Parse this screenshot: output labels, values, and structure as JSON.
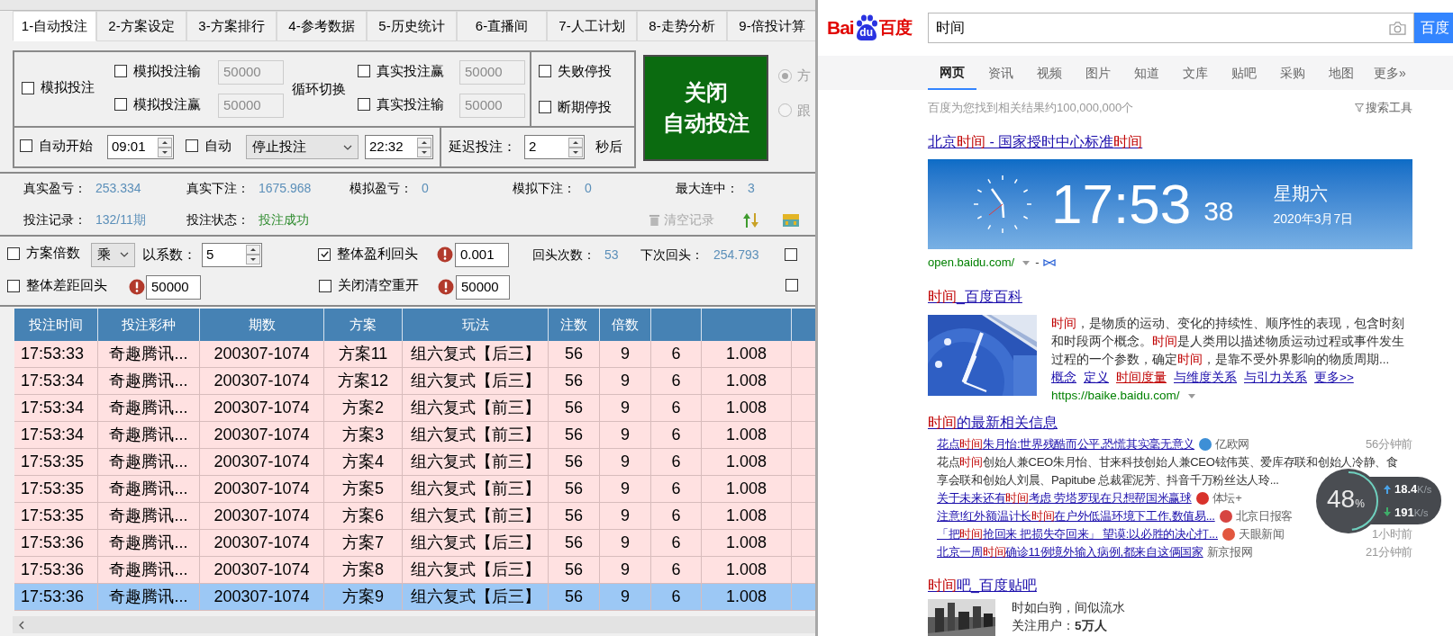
{
  "app": {
    "tabs": [
      {
        "label": "1-自动投注",
        "selected": true
      },
      {
        "label": "2-方案设定",
        "selected": false
      },
      {
        "label": "3-方案排行",
        "selected": false
      },
      {
        "label": "4-参考数据",
        "selected": false
      },
      {
        "label": "5-历史统计",
        "selected": false
      },
      {
        "label": "6-直播间",
        "selected": false
      },
      {
        "label": "7-人工计划",
        "selected": false
      },
      {
        "label": "8-走势分析",
        "selected": false
      },
      {
        "label": "9-倍投计算",
        "selected": false
      }
    ],
    "mode_panel": {
      "simulate": {
        "label": "模拟投注",
        "checked": false
      },
      "switch_rows": [
        {
          "label": "模拟投注输",
          "checked": false,
          "value": "50000",
          "disabled": true
        },
        {
          "label": "模拟投注赢",
          "checked": false,
          "value": "50000",
          "disabled": true
        }
      ],
      "cycle_label": "循环切换",
      "real_rows": [
        {
          "label": "真实投注赢",
          "checked": false,
          "value": "50000",
          "disabled": true
        },
        {
          "label": "真实投注输",
          "checked": false,
          "value": "50000",
          "disabled": true
        }
      ],
      "stop_options": [
        {
          "label": "失败停投",
          "checked": false
        },
        {
          "label": "断期停投",
          "checked": false
        }
      ],
      "toggle_button": [
        "关闭",
        "自动投注"
      ],
      "radios": [
        {
          "label": "方",
          "selected": true
        },
        {
          "label": "跟",
          "selected": false
        }
      ]
    },
    "schedule": {
      "auto_start": {
        "label": "自动开始",
        "checked": false
      },
      "start_time": "09:01",
      "auto": {
        "label": "自动",
        "checked": false
      },
      "action": "停止投注",
      "end_time": "22:32",
      "delay_label": "延迟投注：",
      "delay": "2",
      "delay_unit": "秒后"
    },
    "stats": [
      {
        "label": "真实盈亏：",
        "value": "253.334",
        "kind": "number"
      },
      {
        "label": "真实下注：",
        "value": "1675.968",
        "kind": "number"
      },
      {
        "label": "模拟盈亏：",
        "value": "0",
        "kind": "number"
      },
      {
        "label": "模拟下注：",
        "value": "0",
        "kind": "number"
      },
      {
        "label": "最大连中：",
        "value": "3",
        "kind": "number"
      }
    ],
    "records": [
      {
        "label": "投注记录：",
        "value": "132/11期",
        "kind": "number"
      },
      {
        "label": "投注状态：",
        "value": "投注成功",
        "kind": "status"
      }
    ],
    "clear_button": {
      "label": "清空记录",
      "disabled": true
    },
    "options": {
      "multiplier": {
        "label": "方案倍数",
        "checked": false
      },
      "operator": "乘",
      "factor_label": "以系数：",
      "factor": "5",
      "profit_return": {
        "label": "整体盈利回头",
        "checked": true,
        "value": "0.001"
      },
      "return_count_label": "回头次数：",
      "return_count": "53",
      "next_return_label": "下次回头：",
      "next_return": "254.793",
      "extra_checks": [
        {
          "checked": false
        },
        {
          "checked": false
        }
      ],
      "gap_return": {
        "label": "整体差距回头",
        "checked": false,
        "value": "50000"
      },
      "close_reset": {
        "label": "关闭清空重开",
        "checked": false,
        "value": "50000"
      }
    },
    "table": {
      "columns": [
        "投注时间",
        "投注彩种",
        "期数",
        "方案",
        "玩法",
        "注数",
        "倍数"
      ],
      "rows": [
        {
          "cells": [
            "17:53:33",
            "奇趣腾讯...",
            "200307-1074",
            "方案11",
            "组六复式【后三】",
            "56",
            "9",
            "6",
            "1.008"
          ],
          "selected": false
        },
        {
          "cells": [
            "17:53:34",
            "奇趣腾讯...",
            "200307-1074",
            "方案12",
            "组六复式【后三】",
            "56",
            "9",
            "6",
            "1.008"
          ],
          "selected": false
        },
        {
          "cells": [
            "17:53:34",
            "奇趣腾讯...",
            "200307-1074",
            "方案2",
            "组六复式【前三】",
            "56",
            "9",
            "6",
            "1.008"
          ],
          "selected": false
        },
        {
          "cells": [
            "17:53:34",
            "奇趣腾讯...",
            "200307-1074",
            "方案3",
            "组六复式【前三】",
            "56",
            "9",
            "6",
            "1.008"
          ],
          "selected": false
        },
        {
          "cells": [
            "17:53:35",
            "奇趣腾讯...",
            "200307-1074",
            "方案4",
            "组六复式【前三】",
            "56",
            "9",
            "6",
            "1.008"
          ],
          "selected": false
        },
        {
          "cells": [
            "17:53:35",
            "奇趣腾讯...",
            "200307-1074",
            "方案5",
            "组六复式【前三】",
            "56",
            "9",
            "6",
            "1.008"
          ],
          "selected": false
        },
        {
          "cells": [
            "17:53:35",
            "奇趣腾讯...",
            "200307-1074",
            "方案6",
            "组六复式【前三】",
            "56",
            "9",
            "6",
            "1.008"
          ],
          "selected": false
        },
        {
          "cells": [
            "17:53:36",
            "奇趣腾讯...",
            "200307-1074",
            "方案7",
            "组六复式【后三】",
            "56",
            "9",
            "6",
            "1.008"
          ],
          "selected": false
        },
        {
          "cells": [
            "17:53:36",
            "奇趣腾讯...",
            "200307-1074",
            "方案8",
            "组六复式【后三】",
            "56",
            "9",
            "6",
            "1.008"
          ],
          "selected": false
        },
        {
          "cells": [
            "17:53:36",
            "奇趣腾讯...",
            "200307-1074",
            "方案9",
            "组六复式【后三】",
            "56",
            "9",
            "6",
            "1.008"
          ],
          "selected": true
        }
      ]
    }
  },
  "browser": {
    "logo": [
      "Bai",
      "du",
      "百度"
    ],
    "search_query": "时间",
    "search_button": "百度",
    "nav": [
      {
        "label": "网页",
        "selected": true
      },
      {
        "label": "资讯",
        "selected": false
      },
      {
        "label": "视频",
        "selected": false
      },
      {
        "label": "图片",
        "selected": false
      },
      {
        "label": "知道",
        "selected": false
      },
      {
        "label": "文库",
        "selected": false
      },
      {
        "label": "贴吧",
        "selected": false
      },
      {
        "label": "采购",
        "selected": false
      },
      {
        "label": "地图",
        "selected": false
      },
      {
        "label": "更多»",
        "selected": false
      }
    ],
    "result_count": "百度为您找到相关结果约100,000,000个",
    "tools": "搜索工具",
    "clock_result": {
      "title": [
        {
          "text": "北京",
          "highlight": false
        },
        {
          "text": "时间",
          "highlight": true
        },
        {
          "text": " - 国家授时中心标准",
          "highlight": false
        },
        {
          "text": "时间",
          "highlight": true
        }
      ],
      "time": "17:53",
      "seconds": "38",
      "weekday": "星期六",
      "date": "2020年3月7日",
      "url": "open.baidu.com/",
      "separator": "-"
    },
    "baike_result": {
      "title": [
        {
          "text": "时间",
          "highlight": true
        },
        {
          "text": "_百度百科",
          "highlight": false
        }
      ],
      "snippet": [
        {
          "text": "时间",
          "highlight": true
        },
        {
          "text": "，是物质的运动、变化的持续性、顺序性的表现，包含时刻和时段两个概念。",
          "highlight": false
        },
        {
          "text": "时间",
          "highlight": true
        },
        {
          "text": "是人类用以描述物质运动过程或事件发生过程的一个参数，确定",
          "highlight": false
        },
        {
          "text": "时间",
          "highlight": true
        },
        {
          "text": "，是靠不受外界影响的物质周期...",
          "highlight": false
        }
      ],
      "links": [
        {
          "text": "概念",
          "highlight": false
        },
        {
          "text": "定义",
          "highlight": false
        },
        {
          "text": "时间度量",
          "highlight": true
        },
        {
          "text": "与维度关系",
          "highlight": false
        },
        {
          "text": "与引力关系",
          "highlight": false
        },
        {
          "text": "更多>>",
          "highlight": false
        }
      ],
      "url": "https://baike.baidu.com/"
    },
    "news_result": {
      "title": [
        {
          "text": "时间",
          "highlight": true
        },
        {
          "text": "的最新相关信息",
          "highlight": false
        }
      ],
      "items": [
        {
          "headline": [
            {
              "text": "花点",
              "highlight": false
            },
            {
              "text": "时间",
              "highlight": true
            },
            {
              "text": "朱月怡:世界残酷而公平,恐慌其实毫无意义",
              "highlight": false
            }
          ],
          "source": "亿欧网",
          "color": "#3d8fd6",
          "time": "56分钟前",
          "summary_lines": [
            [
              {
                "text": "花点",
                "highlight": false
              },
              {
                "text": "时间",
                "highlight": true
              },
              {
                "text": "创始人兼CEO朱月怡、甘来科技创始人兼CEO铉伟英、爱库存联和创始人冷静、食",
                "highlight": false
              }
            ],
            [
              {
                "text": "享会联和创始人刘晨、Papitube 总裁霍泥芳、抖音千万粉丝达人玲...",
                "highlight": false
              }
            ]
          ]
        },
        {
          "headline": [
            {
              "text": "关于未来还有",
              "highlight": false
            },
            {
              "text": "时间",
              "highlight": true
            },
            {
              "text": "考虑 劳塔罗现在只想帮国米赢球",
              "highlight": false
            }
          ],
          "source": "体坛+",
          "color": "#d8322b"
        },
        {
          "headline": [
            {
              "text": "注意!红外额温计长",
              "highlight": false
            },
            {
              "text": "时间",
              "highlight": true
            },
            {
              "text": "在户外低温环境下工作,数值易...",
              "highlight": false
            }
          ],
          "source": "北京日报客",
          "color": "#d64541"
        },
        {
          "headline": [
            {
              "text": "「把",
              "highlight": false
            },
            {
              "text": "时间",
              "highlight": true
            },
            {
              "text": "抢回来 把损失夺回来」 望谟:以必胜的决心打...",
              "highlight": false
            }
          ],
          "source": "天眼新闻",
          "color": "#e2573f",
          "time": "1小时前"
        },
        {
          "headline": [
            {
              "text": "北京一周",
              "highlight": false
            },
            {
              "text": "时间",
              "highlight": true
            },
            {
              "text": "确诊11例境外输入病例,都来自这俩国家",
              "highlight": false
            }
          ],
          "source": "新京报网",
          "time": "21分钟前"
        }
      ]
    },
    "tieba_result": {
      "title": [
        {
          "text": "时间",
          "highlight": true
        },
        {
          "text": "吧_百度贴吧",
          "highlight": false
        }
      ],
      "lines": [
        "时如白驹，间似流水",
        "关注用户：**5万人**"
      ]
    }
  },
  "speed_widget": {
    "percent": "48",
    "unit": "%",
    "upload": "18.4",
    "upload_unit": "K/s",
    "download": "191",
    "download_unit": "K/s"
  }
}
